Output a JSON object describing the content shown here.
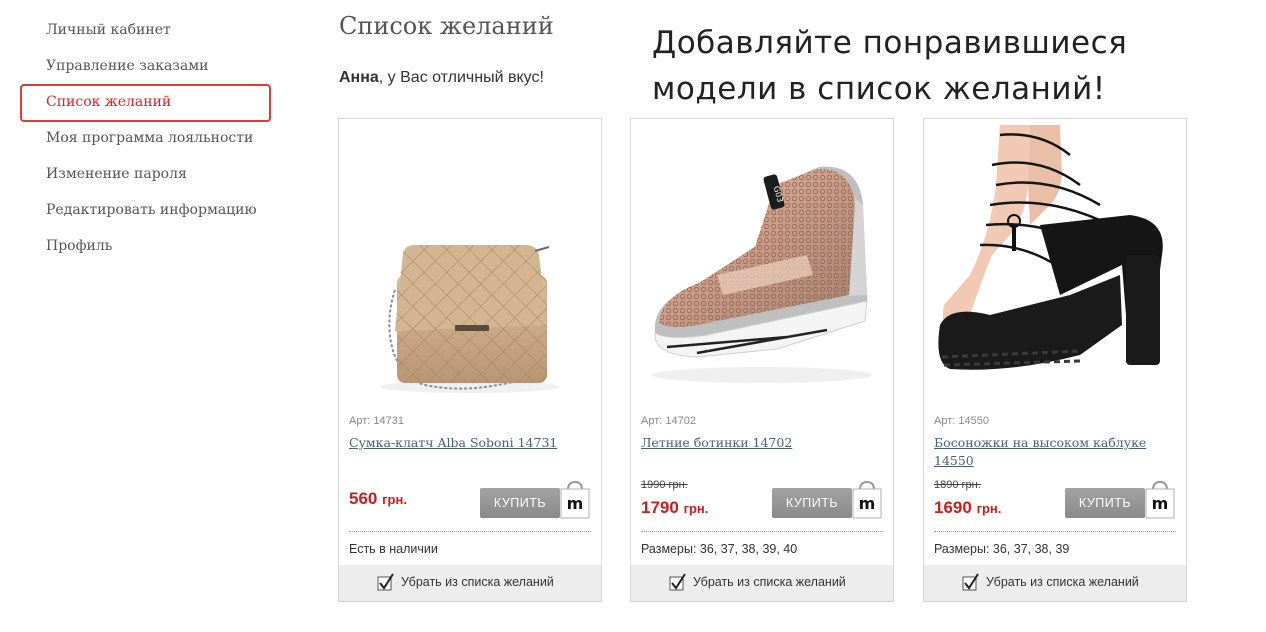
{
  "sidebar": {
    "items": [
      {
        "label": "Личный кабинет",
        "active": false
      },
      {
        "label": "Управление заказами",
        "active": false
      },
      {
        "label": "Список желаний",
        "active": true
      },
      {
        "label": "Моя программа лояльности",
        "active": false
      },
      {
        "label": "Изменение пароля",
        "active": false
      },
      {
        "label": "Редактировать информацию",
        "active": false
      },
      {
        "label": "Профиль",
        "active": false
      }
    ]
  },
  "header": {
    "title": "Список желаний",
    "greeting_name": "Анна",
    "greeting_rest": ", у Вас отличный вкус!",
    "promo_line1": "Добавляйте понравившиеся",
    "promo_line2": "модели в список желаний!"
  },
  "products": [
    {
      "sku": "Арт: 14731",
      "name": "Сумка-клатч Alba Soboni 14731",
      "old_price": "",
      "price": "560",
      "currency": "грн.",
      "buy_label": "КУПИТЬ",
      "info": "Есть в наличии",
      "remove_label": "Убрать из списка желаний",
      "image": "quilted-beige-clutch-bag"
    },
    {
      "sku": "Арт: 14702",
      "name": "Летние ботинки 14702",
      "old_price": "1990 грн.",
      "price": "1790",
      "currency": "грн.",
      "buy_label": "КУПИТЬ",
      "info": "Размеры: 36, 37, 38, 39, 40",
      "remove_label": "Убрать из списка желаний",
      "image": "rose-gold-mesh-wedge-sneaker"
    },
    {
      "sku": "Арт: 14550",
      "name": "Босоножки на высоком каблуке 14550",
      "old_price": "1890 грн.",
      "price": "1690",
      "currency": "грн.",
      "buy_label": "КУПИТЬ",
      "info": "Размеры: 36, 37, 38, 39",
      "remove_label": "Убрать из списка желаний",
      "image": "black-lace-up-platform-heels"
    }
  ],
  "colors": {
    "accent": "#d7262b",
    "link": "#4a5f7c",
    "price": "#c8201c",
    "button": "#999999"
  }
}
